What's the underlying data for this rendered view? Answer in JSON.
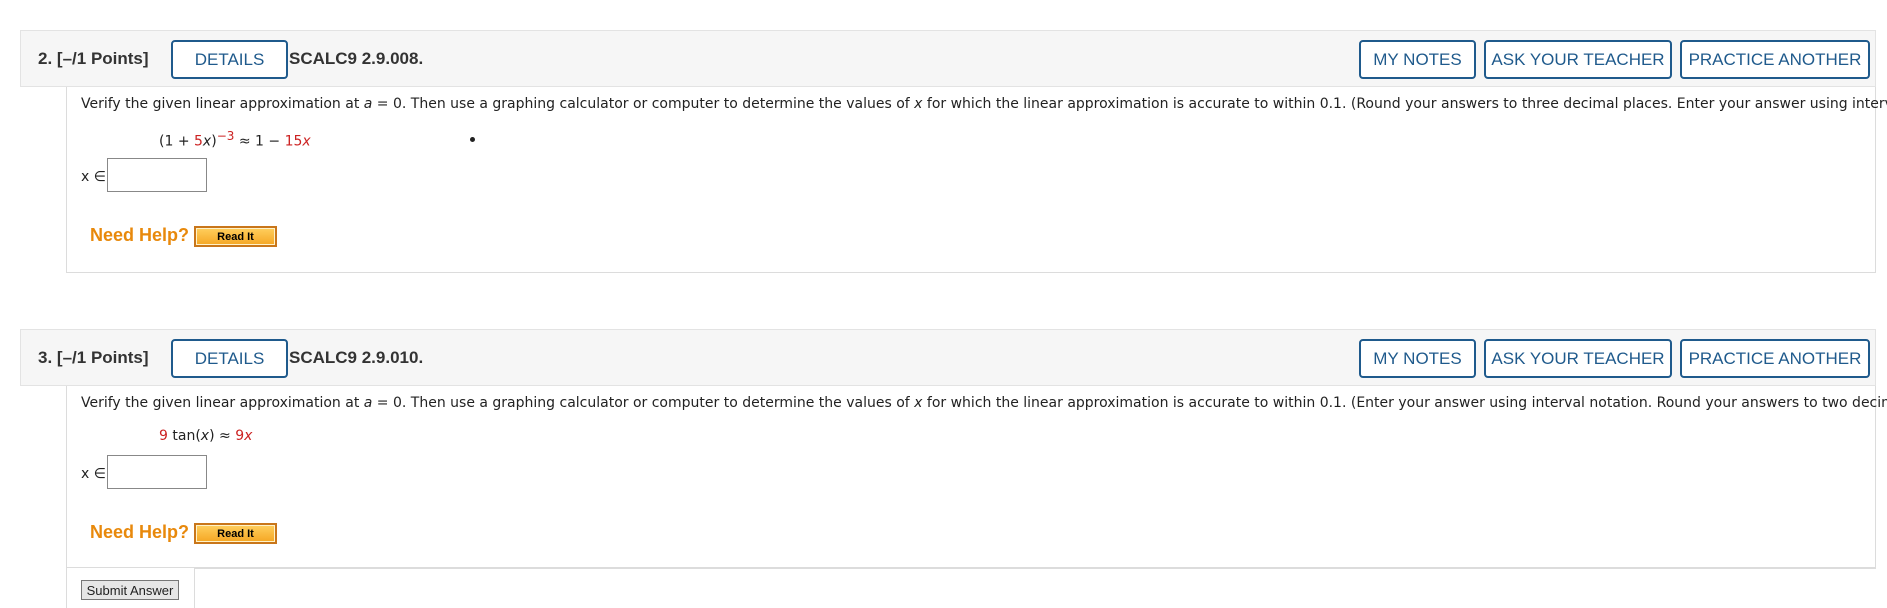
{
  "questions": [
    {
      "number_label": "2.",
      "points_label": "[–/1 Points]",
      "details_label": "DETAILS",
      "code": "SCALC9 2.9.008.",
      "my_notes_label": "MY NOTES",
      "ask_teacher_label": "ASK YOUR TEACHER",
      "practice_label": "PRACTICE ANOTHER",
      "prompt": {
        "p1": "Verify the given linear approximation at ",
        "a": "a",
        "p2": " = 0. Then use a graphing calculator or computer to determine the values of ",
        "x": "x",
        "p3": " for which the linear approximation is accurate to within 0.1. (Round your answers to three decimal places. Enter your answer using interval notation.)"
      },
      "math": {
        "open": "(1 + ",
        "coef": "5",
        "var1": "x",
        "close": ")",
        "exponent": "−3",
        "approx": " ≈ 1 − ",
        "coef2": "15",
        "var2": "x"
      },
      "answer_label": "x ∈",
      "answer_value": "",
      "need_help_label": "Need Help?",
      "read_it_label": "Read It"
    },
    {
      "number_label": "3.",
      "points_label": "[–/1 Points]",
      "details_label": "DETAILS",
      "code": "SCALC9 2.9.010.",
      "my_notes_label": "MY NOTES",
      "ask_teacher_label": "ASK YOUR TEACHER",
      "practice_label": "PRACTICE ANOTHER",
      "prompt": {
        "p1": "Verify the given linear approximation at ",
        "a": "a",
        "p2": " = 0. Then use a graphing calculator or computer to determine the values of ",
        "x": "x",
        "p3": " for which the linear approximation is accurate to within 0.1. (Enter your answer using interval notation. Round your answers to two decimal places.)"
      },
      "math": {
        "coef": "9",
        "func": " tan(",
        "var1": "x",
        "close": ")",
        "approx": " ≈ ",
        "coef2": "9",
        "var2": "x"
      },
      "answer_label": "x ∈",
      "answer_value": "",
      "need_help_label": "Need Help?",
      "read_it_label": "Read It"
    }
  ],
  "submit_label": "Submit Answer",
  "colors": {
    "button_blue": "#1f5a8c",
    "help_orange": "#e8890c",
    "math_red": "#cc2222"
  }
}
